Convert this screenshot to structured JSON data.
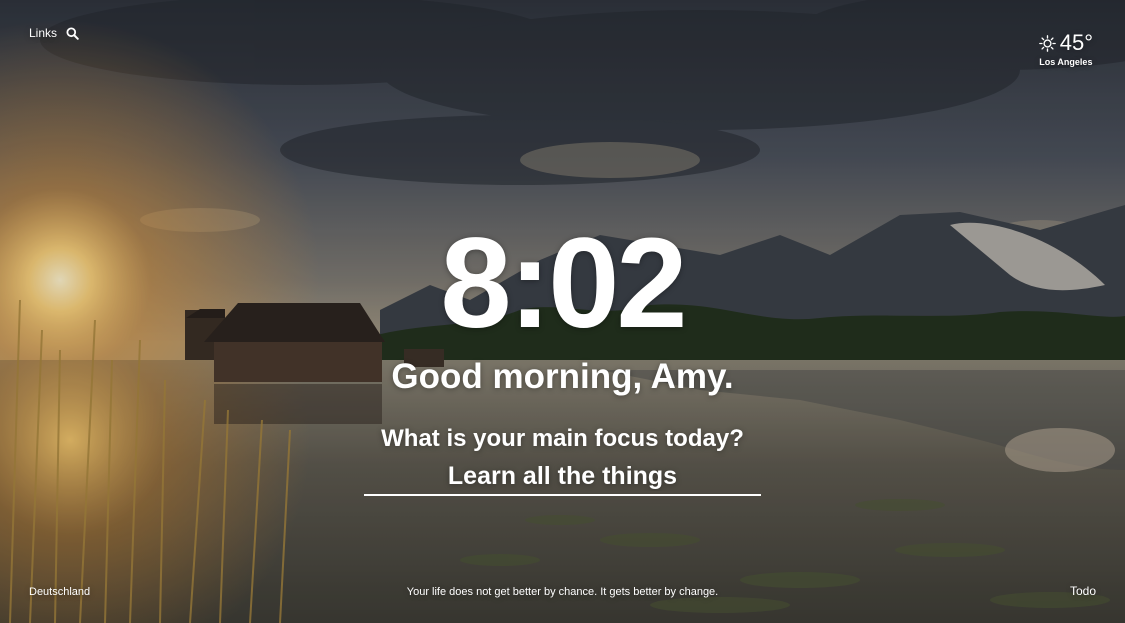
{
  "top_left": {
    "links_label": "Links",
    "search_icon": "search-icon"
  },
  "weather": {
    "icon": "sun-icon",
    "temperature": "45°",
    "location": "Los Angeles"
  },
  "clock": {
    "time": "8:02"
  },
  "greeting": {
    "text": "Good morning, Amy."
  },
  "focus": {
    "question": "What is your main focus today?",
    "value": "Learn all the things"
  },
  "footer": {
    "location_label": "Deutschland",
    "quote": "Your life does not get better by chance. It gets better by change.",
    "todo_label": "Todo"
  },
  "colors": {
    "text": "#ffffff",
    "sky_dark": "#3c434e",
    "sun_glow": "#f7b54a",
    "water": "#6f6a5e"
  }
}
